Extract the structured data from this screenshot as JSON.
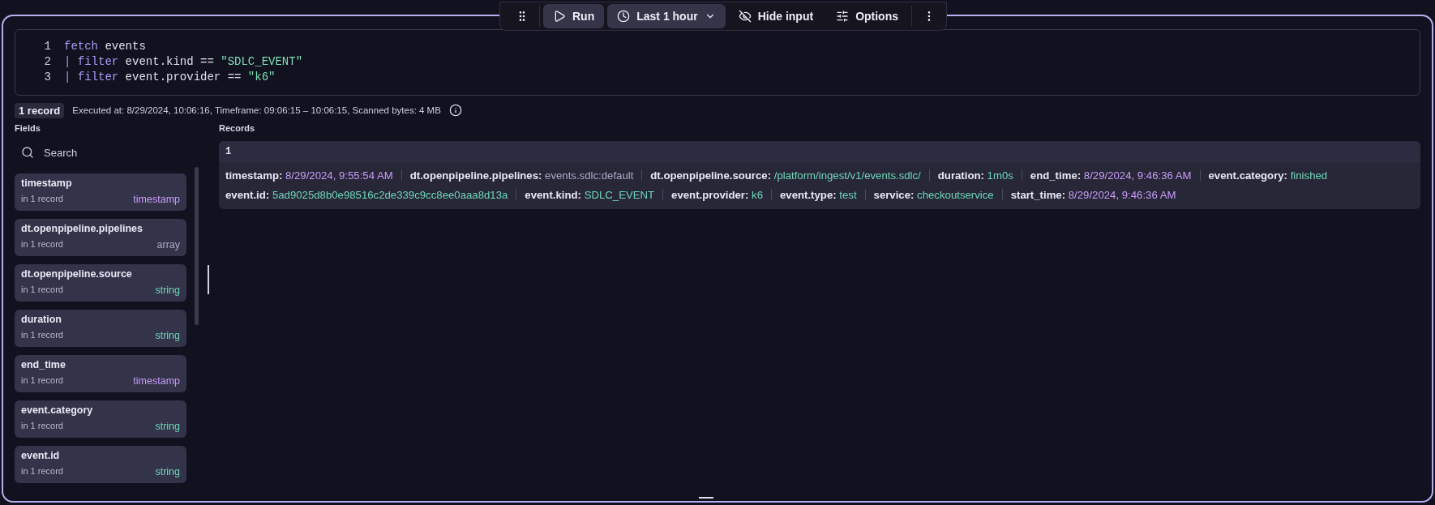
{
  "toolbar": {
    "items": [
      {
        "kind": "filled",
        "label": "Run"
      },
      {
        "kind": "filled",
        "label": "Last 1 hour",
        "dropdown": true
      },
      {
        "kind": "plain",
        "label": "Hide input"
      },
      {
        "kind": "plain",
        "label": "Options"
      }
    ]
  },
  "editor": {
    "lines": [
      {
        "number": "1",
        "tokens": [
          {
            "kind": "keyword",
            "text": "fetch"
          },
          {
            "kind": "plain",
            "text": " events"
          }
        ]
      },
      {
        "number": "2",
        "tokens": [
          {
            "kind": "keyword",
            "text": "| filter"
          },
          {
            "kind": "plain",
            "text": " event.kind == "
          },
          {
            "kind": "string",
            "text": "\"SDLC_EVENT\""
          }
        ]
      },
      {
        "number": "3",
        "tokens": [
          {
            "kind": "keyword",
            "text": "| filter"
          },
          {
            "kind": "plain",
            "text": " event.provider == "
          },
          {
            "kind": "string",
            "text": "\"k6\""
          }
        ]
      }
    ]
  },
  "status": {
    "badge": "1 record",
    "info": "Executed at: 8/29/2024, 10:06:16, Timeframe: 09:06:15 – 10:06:15, Scanned bytes: 4 MB"
  },
  "fields": {
    "title": "Fields",
    "search": {
      "placeholder": "Search"
    },
    "items": [
      {
        "name": "timestamp",
        "count": "in 1 record",
        "type": "timestamp"
      },
      {
        "name": "dt.openpipeline.pipelines",
        "count": "in 1 record",
        "type": "array"
      },
      {
        "name": "dt.openpipeline.source",
        "count": "in 1 record",
        "type": "string"
      },
      {
        "name": "duration",
        "count": "in 1 record",
        "type": "string"
      },
      {
        "name": "end_time",
        "count": "in 1 record",
        "type": "timestamp"
      },
      {
        "name": "event.category",
        "count": "in 1 record",
        "type": "string"
      },
      {
        "name": "event.id",
        "count": "in 1 record",
        "type": "string"
      }
    ]
  },
  "records": {
    "title": "Records",
    "rows": [
      {
        "index": "1",
        "lines": [
          [
            {
              "key": "timestamp:",
              "value": "8/29/2024, 9:55:54 AM",
              "kind": "timestamp"
            },
            {
              "key": "dt.openpipeline.pipelines:",
              "value": "events.sdlc:default",
              "kind": "array"
            },
            {
              "key": "dt.openpipeline.source:",
              "value": "/platform/ingest/v1/events.sdlc/",
              "kind": "string"
            },
            {
              "key": "duration:",
              "value": "1m0s",
              "kind": "string"
            },
            {
              "key": "end_time:",
              "value": "8/29/2024, 9:46:36 AM",
              "kind": "timestamp"
            },
            {
              "key": "event.category:",
              "value": "finished",
              "kind": "string"
            }
          ],
          [
            {
              "key": "event.id:",
              "value": "5ad9025d8b0e98516c2de339c9cc8ee0aaa8d13a",
              "kind": "string"
            },
            {
              "key": "event.kind:",
              "value": "SDLC_EVENT",
              "kind": "string"
            },
            {
              "key": "event.provider:",
              "value": "k6",
              "kind": "string"
            },
            {
              "key": "event.type:",
              "value": "test",
              "kind": "string"
            },
            {
              "key": "service:",
              "value": "checkoutservice",
              "kind": "string"
            },
            {
              "key": "start_time:",
              "value": "8/29/2024, 9:46:36 AM",
              "kind": "timestamp"
            }
          ]
        ]
      }
    ]
  }
}
